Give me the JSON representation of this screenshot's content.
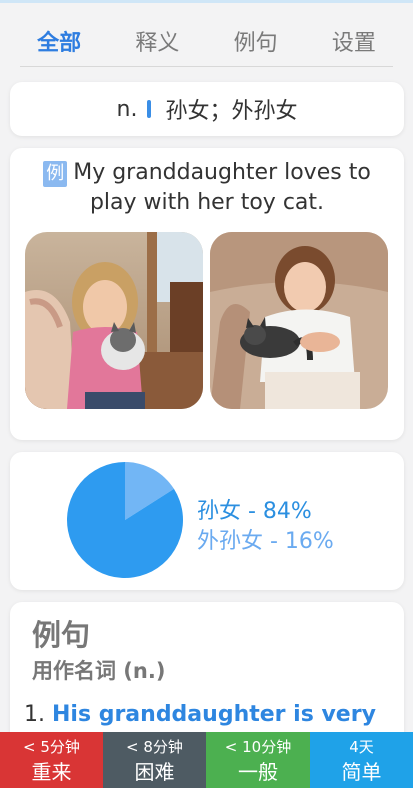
{
  "tabs": [
    {
      "label": "全部",
      "active": true
    },
    {
      "label": "释义",
      "active": false
    },
    {
      "label": "例句",
      "active": false
    },
    {
      "label": "设置",
      "active": false
    }
  ],
  "definition": {
    "pos": "n.",
    "meaning": "孙女；外孙女"
  },
  "example": {
    "badge": "例",
    "sentence": "My granddaughter loves to play with her toy cat."
  },
  "images": [
    {
      "name": "girl-with-kitten-photo-1"
    },
    {
      "name": "girl-with-kitten-photo-2"
    }
  ],
  "usage": {
    "label_1": "孙女 - 84%",
    "label_2": "外孙女 - 16%",
    "share_1": 0.84,
    "share_2": 0.16,
    "colors": {
      "main": "#2e9bf0",
      "minor": "#72b6f5"
    }
  },
  "sentences": {
    "title": "例句",
    "subtitle": "用作名词 (n.)",
    "items": [
      {
        "number": "1.",
        "text": "His granddaughter is very"
      }
    ]
  },
  "review_buttons": [
    {
      "time": "< 5分钟",
      "label": "重来",
      "color": "#d93535"
    },
    {
      "time": "< 8分钟",
      "label": "困难",
      "color": "#4e5b63"
    },
    {
      "time": "< 10分钟",
      "label": "一般",
      "color": "#4cb050"
    },
    {
      "time": "4天",
      "label": "简单",
      "color": "#1fa2e8"
    }
  ]
}
